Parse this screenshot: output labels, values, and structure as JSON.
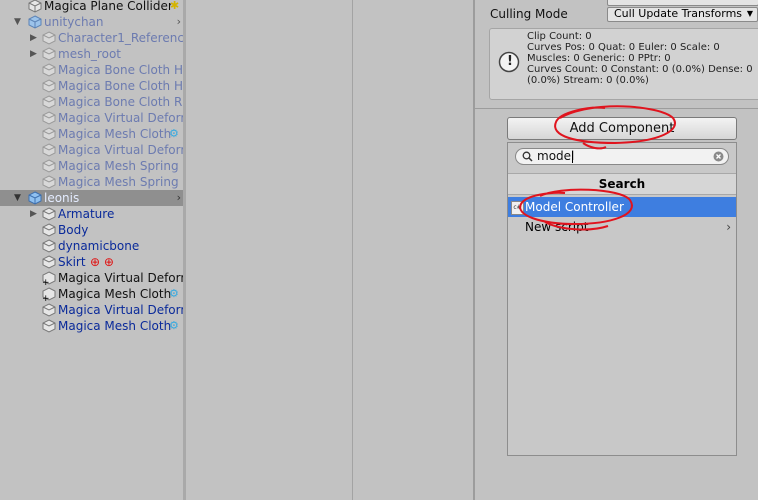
{
  "hierarchy": {
    "rows": [
      {
        "label": "Magica Plane Collider",
        "badge": "✱"
      },
      {
        "label": "unitychan"
      },
      {
        "label": "Character1_Reference"
      },
      {
        "label": "mesh_root"
      },
      {
        "label": "Magica Bone Cloth Ha"
      },
      {
        "label": "Magica Bone Cloth Ha"
      },
      {
        "label": "Magica Bone Cloth Rib"
      },
      {
        "label": "Magica Virtual Deform"
      },
      {
        "label": "Magica Mesh Cloth",
        "badge": "⚙"
      },
      {
        "label": "Magica Virtual Deform"
      },
      {
        "label": "Magica Mesh Spring B"
      },
      {
        "label": "Magica Mesh Spring B"
      },
      {
        "label": "leonis"
      },
      {
        "label": "Armature"
      },
      {
        "label": "Body"
      },
      {
        "label": "dynamicbone"
      },
      {
        "label": "Skirt",
        "badge": "⊕ ⊕"
      },
      {
        "label": "Magica Virtual Deform"
      },
      {
        "label": "Magica Mesh Cloth",
        "badge": "⚙"
      },
      {
        "label": "Magica Virtual Deform"
      },
      {
        "label": "Magica Mesh Cloth",
        "badge": "⚙"
      }
    ]
  },
  "inspector": {
    "culling_label": "Culling Mode",
    "culling_value": "Cull Update Transforms",
    "info_lines": "Clip Count: 0\nCurves Pos: 0 Quat: 0 Euler: 0 Scale: 0\nMuscles: 0 Generic: 0 PPtr: 0\nCurves Count: 0 Constant: 0 (0.0%) Dense: 0\n(0.0%) Stream: 0 (0.0%)",
    "info_icon": "!",
    "add_component": "Add Component",
    "search_value": "model",
    "search_header": "Search",
    "results": [
      {
        "label": "Model Controller",
        "icon": "c#"
      },
      {
        "label": "New script"
      }
    ]
  },
  "colors": {
    "selected_blue": "#3e7ee0",
    "annotation_red": "#e0141e"
  }
}
